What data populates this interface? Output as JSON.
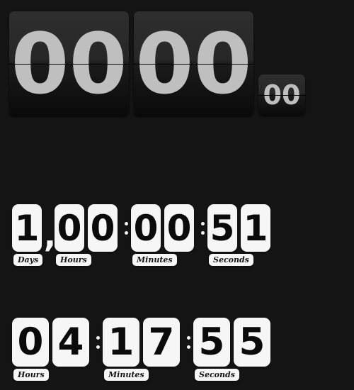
{
  "theme": {
    "background": "#141414",
    "tile_face": "#f6f6f6",
    "tile_text": "#0b0b0b",
    "flip_panel_top": "#2e2e2e",
    "flip_panel_bottom": "#0a0a0a",
    "flip_digit_color": "#bfbfbf",
    "seam_color": "#000000"
  },
  "flip_clock": {
    "name": "flip-clock",
    "panels": [
      {
        "id": "a",
        "digits": "00",
        "size": "large"
      },
      {
        "id": "b",
        "digits": "00",
        "size": "large"
      },
      {
        "id": "c",
        "digits": "00",
        "size": "small"
      }
    ]
  },
  "counter_top": {
    "name": "countdown-with-days",
    "groups": [
      {
        "label": "Days",
        "digits": [
          "1"
        ]
      },
      {
        "label": "Hours",
        "digits": [
          "0",
          "0"
        ]
      },
      {
        "label": "Minutes",
        "digits": [
          "0",
          "0"
        ]
      },
      {
        "label": "Seconds",
        "digits": [
          "5",
          "1"
        ]
      }
    ],
    "separators": {
      "comma": ",",
      "colon": ":"
    },
    "readout": "1,00:00:51"
  },
  "counter_bottom": {
    "name": "countdown-hours-minutes-seconds",
    "groups": [
      {
        "label": "Hours",
        "digits": [
          "0",
          "4"
        ]
      },
      {
        "label": "Minutes",
        "digits": [
          "1",
          "7"
        ]
      },
      {
        "label": "Seconds",
        "digits": [
          "5",
          "5"
        ]
      }
    ],
    "separators": {
      "colon": ":"
    },
    "readout": "04:17:55"
  }
}
